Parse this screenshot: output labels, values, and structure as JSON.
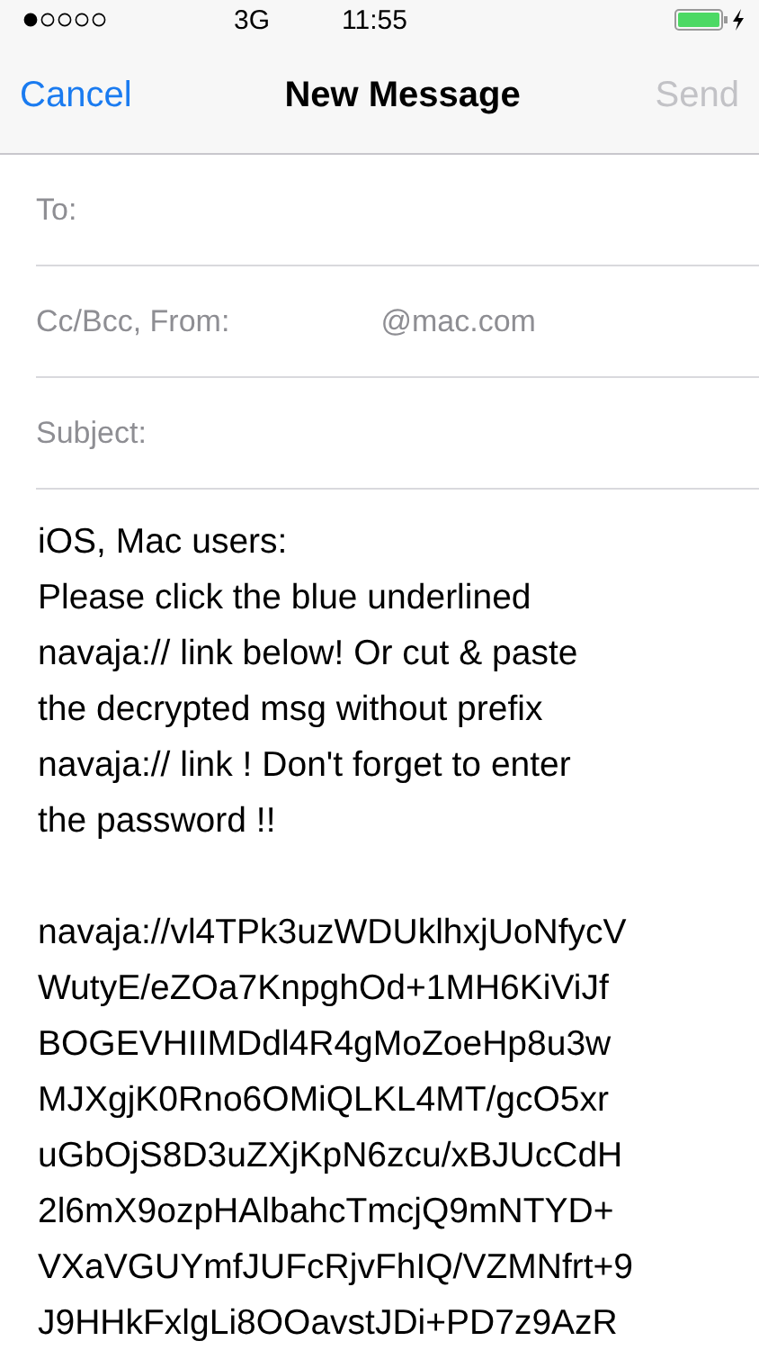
{
  "status_bar": {
    "network": "3G",
    "time": "11:55"
  },
  "nav_bar": {
    "cancel": "Cancel",
    "title": "New Message",
    "send": "Send",
    "send_disabled": true
  },
  "fields": [
    {
      "label": "To:"
    },
    {
      "label": "Cc/Bcc, From:",
      "value": "@mac.com"
    },
    {
      "label": "Subject:"
    }
  ],
  "body": {
    "paragraph_lines": [
      "iOS, Mac users:",
      "Please click the blue underlined",
      "navaja:// link below! Or cut & paste",
      "the decrypted msg without prefix",
      "navaja:// link ! Don't forget to enter",
      "the password !!"
    ],
    "code_lines": [
      "navaja://vl4TPk3uzWDUklhxjUoNfycV",
      "WutyE/eZOa7KnpghOd+1MH6KiViJf",
      "BOGEVHIIMDdl4R4gMoZoeHp8u3w",
      "MJXgjK0Rno6OMiQLKL4MT/gcO5xr",
      "uGbOjS8D3uZXjKpN6zcu/xBJUcCdH",
      "2l6mX9ozpHAlbahcTmcjQ9mNTYD+",
      "VXaVGUYmfJUFcRjvFhIQ/VZMNfrt+9",
      "J9HHkFxlgLi8OOavstJDi+PD7z9AzR"
    ]
  }
}
